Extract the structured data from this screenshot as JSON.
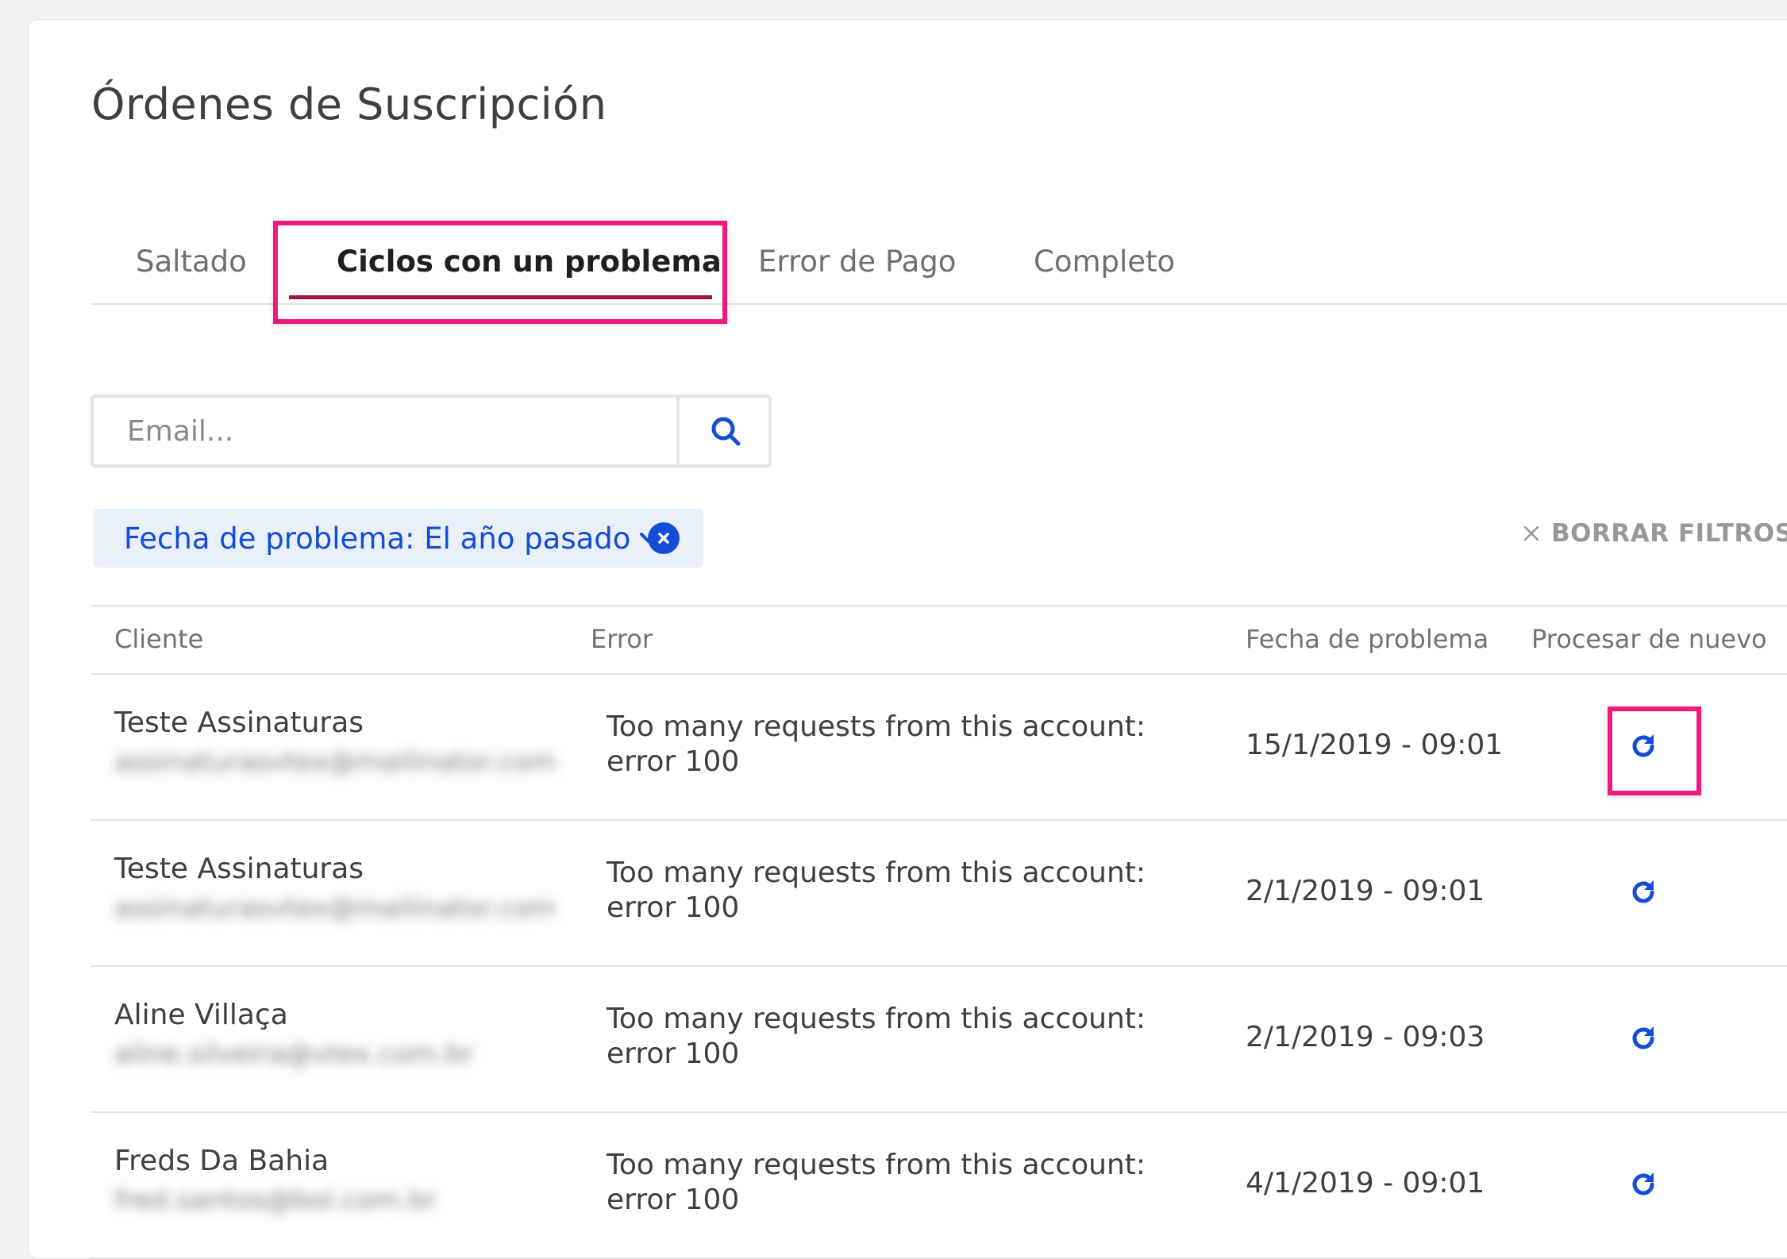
{
  "page": {
    "title": "Órdenes de Suscripción"
  },
  "tabs": [
    {
      "label": "Saltado",
      "active": false
    },
    {
      "label": "Ciclos con un problema",
      "active": true
    },
    {
      "label": "Error de Pago",
      "active": false
    },
    {
      "label": "Completo",
      "active": false
    }
  ],
  "search": {
    "placeholder": "Email...",
    "value": "",
    "icon": "search-icon"
  },
  "filters": {
    "chip_label": "Fecha de problema: El año pasado",
    "chip_icons": [
      "chevron-down-icon",
      "remove-filter-icon"
    ],
    "clear_label": "BORRAR FILTROS",
    "clear_icon": "close-icon"
  },
  "table": {
    "columns": [
      "Cliente",
      "Error",
      "Fecha de problema",
      "Procesar de nuevo"
    ],
    "rows": [
      {
        "client_name": "Teste Assinaturas",
        "client_email": "assinaturasvtex@mailinator.com",
        "error": "Too many requests from this account: error 100",
        "date": "15/1/2019 - 09:01",
        "action_icon": "refresh-icon"
      },
      {
        "client_name": "Teste Assinaturas",
        "client_email": "assinaturasvtex@mailinator.com",
        "error": "Too many requests from this account: error 100",
        "date": "2/1/2019 - 09:01",
        "action_icon": "refresh-icon"
      },
      {
        "client_name": "Aline Villaça",
        "client_email": "aline.silveira@vtex.com.br",
        "error": "Too many requests from this account: error 100",
        "date": "2/1/2019 - 09:03",
        "action_icon": "refresh-icon"
      },
      {
        "client_name": "Freds Da Bahia",
        "client_email": "fred.santos@bol.com.br",
        "error": "Too many requests from this account: error 100",
        "date": "4/1/2019 - 09:01",
        "action_icon": "refresh-icon"
      }
    ]
  },
  "colors": {
    "accent": "#134cd8",
    "tab_underline": "#a2164a",
    "highlight": "#f0197d",
    "chip_background": "#eaf0fa"
  }
}
